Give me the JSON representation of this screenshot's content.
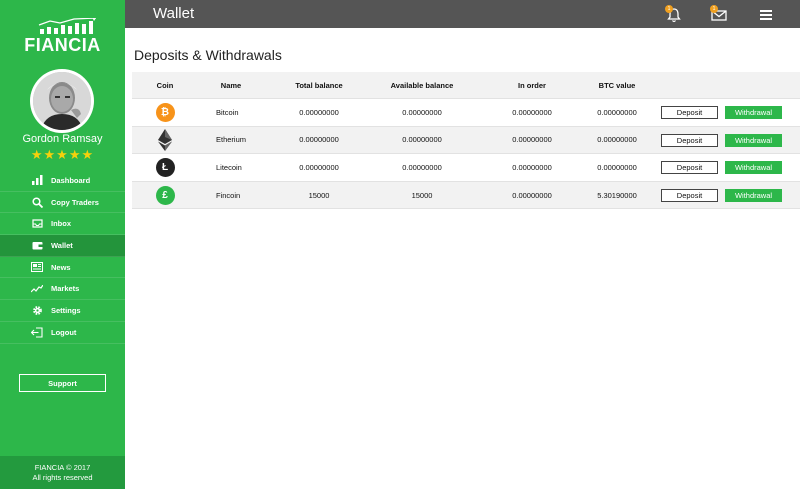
{
  "brand": {
    "name": "FIANCIA"
  },
  "user": {
    "name": "Gordon Ramsay",
    "stars": "★★★★★"
  },
  "nav": [
    {
      "label": "Dashboard",
      "icon": "bar-chart-icon",
      "active": false
    },
    {
      "label": "Copy Traders",
      "icon": "search-icon",
      "active": false
    },
    {
      "label": "Inbox",
      "icon": "inbox-icon",
      "active": false
    },
    {
      "label": "Wallet",
      "icon": "wallet-icon",
      "active": true
    },
    {
      "label": "News",
      "icon": "newspaper-icon",
      "active": false
    },
    {
      "label": "Markets",
      "icon": "trend-line-icon",
      "active": false
    },
    {
      "label": "Settings",
      "icon": "gear-icon",
      "active": false
    },
    {
      "label": "Logout",
      "icon": "logout-icon",
      "active": false
    }
  ],
  "support_label": "Support",
  "footer": {
    "line1": "FIANCIA © 2017",
    "line2": "All rights reserved"
  },
  "header": {
    "title": "Wallet",
    "notifications_badge": "1",
    "messages_badge": "1"
  },
  "main": {
    "section_title": "Deposits & Withdrawals",
    "columns": [
      "Coin",
      "Name",
      "Total balance",
      "Available balance",
      "In order",
      "BTC value"
    ],
    "rows": [
      {
        "icon": "bitcoin-icon",
        "color": "#f7931a",
        "glyph": "₿",
        "name": "Bitcoin",
        "total": "0.00000000",
        "available": "0.00000000",
        "in_order": "0.00000000",
        "btc_value": "0.00000000",
        "deposit": "Deposit",
        "withdraw": "Withdrawal"
      },
      {
        "icon": "ethereum-icon",
        "color": "#333333",
        "glyph": "",
        "name": "Etherium",
        "total": "0.00000000",
        "available": "0.00000000",
        "in_order": "0.00000000",
        "btc_value": "0.00000000",
        "deposit": "Deposit",
        "withdraw": "Withdrawal"
      },
      {
        "icon": "litecoin-icon",
        "color": "#222222",
        "glyph": "Ł",
        "name": "Litecoin",
        "total": "0.00000000",
        "available": "0.00000000",
        "in_order": "0.00000000",
        "btc_value": "0.00000000",
        "deposit": "Deposit",
        "withdraw": "Withdrawal"
      },
      {
        "icon": "fincoin-icon",
        "color": "#2db74a",
        "glyph": "£",
        "name": "Fincoin",
        "total": "15000",
        "available": "15000",
        "in_order": "0.00000000",
        "btc_value": "5.30190000",
        "deposit": "Deposit",
        "withdraw": "Withdrawal"
      }
    ]
  },
  "colors": {
    "sidebar": "#2db74a",
    "accent": "#2db74a",
    "header": "#555555",
    "badge": "#f0a020",
    "stars": "#f5d10c"
  }
}
